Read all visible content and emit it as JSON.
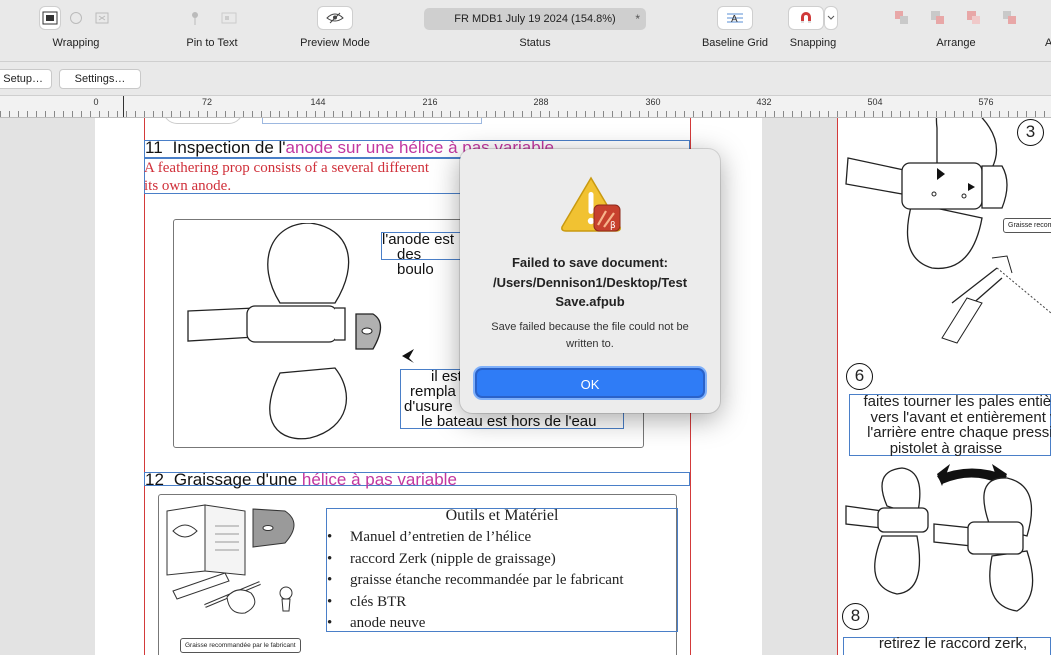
{
  "toolbar": {
    "wrapping_label": "Wrapping",
    "pin_label": "Pin to Text",
    "preview_label": "Preview Mode",
    "status_label": "Status",
    "status_text": "FR MDB1  July 19 2024 (154.8%)",
    "status_modified": "*",
    "baseline_label": "Baseline Grid",
    "snapping_label": "Snapping",
    "arrange_label": "Arrange",
    "overflow_label": "A"
  },
  "context_bar": {
    "setup_label": "Setup…",
    "settings_label": "Settings…"
  },
  "ruler": {
    "labels": [
      "0",
      "72",
      "144",
      "216",
      "288",
      "360",
      "432",
      "504",
      "576"
    ]
  },
  "document": {
    "section11": {
      "number": "11",
      "title_black": "Inspection de l'",
      "title_pink": "anode sur une hélice à pas variable",
      "red_line1": "A feathering prop consists of a several different",
      "red_line2": "its own anode.",
      "callout1_line1": "l'anode est",
      "callout1_line2": "des boulo",
      "callout2_line1": "il est",
      "callout2_line2": "rempla",
      "callout2_line3": "d'usure",
      "callout2_line4": "le bateau est hors de l'eau"
    },
    "section12": {
      "number": "12",
      "title_black": "Graissage d'une ",
      "title_pink": "hélice à pas variable",
      "tools_title": "Outils et Matériel",
      "tools": [
        "Manuel d’entretien de l’hélice",
        "raccord Zerk (nipple de graissage)",
        "graisse étanche recommandée par le fabricant",
        "clés BTR",
        "anode neuve"
      ],
      "grease_label": "Graisse recommandée par le fabricant"
    },
    "right_page": {
      "step3": "3",
      "step6": "6",
      "step8": "8",
      "grease_tag": "Graisse recomm",
      "step6_line1": "faites tourner les pales entière",
      "step6_line2": "vers l'avant et entièrement v",
      "step6_line3": "l'arrière entre chaque pressio",
      "step6_line4": "pistolet à graisse",
      "step8_line1": "retirez le raccord zerk,"
    }
  },
  "dialog": {
    "title": "Failed to save document: /Users/Dennison1/Desktop/Test Save.afpub",
    "message": "Save failed because the file could not be written to.",
    "ok_label": "OK",
    "icon_badge": "β"
  },
  "colors": {
    "accent_blue": "#2f7cf6",
    "frame_blue": "#4a7fc8",
    "margin_red": "#d33a3a",
    "heading_pink": "#c2379f",
    "body_red": "#d0303a"
  }
}
